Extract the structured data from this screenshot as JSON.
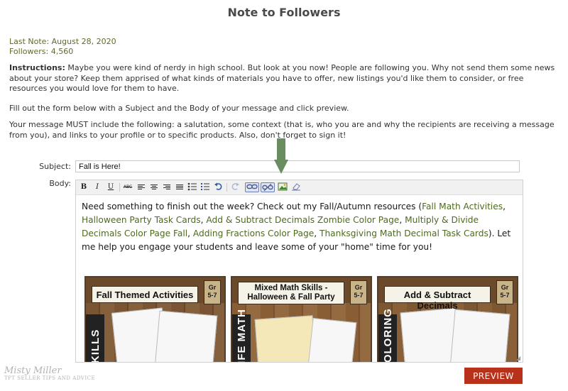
{
  "page": {
    "title": "Note to Followers",
    "last_note": "Last Note: August 28, 2020",
    "followers": "Followers: 4,560"
  },
  "instructions": {
    "label": "Instructions:",
    "text": " Maybe you were kind of nerdy in high school. But look at you now! People are following you. Why not send them some news about your store? Keep them apprised of what kinds of materials you have to offer, new listings you'd like them to consider, or free resources you would love for them to have.",
    "fill_out": "Fill out the form below with a Subject and the Body of your message and click preview.",
    "must_include": "Your message MUST include the following: a salutation, some context (that is, who you are and why the recipients are receiving a message from you), and links to your profile or to specific products. Also, don't forget to sign it!"
  },
  "form": {
    "subject_label": "Subject:",
    "subject_value": "Fall is Here!",
    "body_label": "Body:"
  },
  "toolbar": {
    "bold": "B",
    "italic": "I",
    "underline": "U",
    "spellcheck": "ABC"
  },
  "body": {
    "intro": "Need something to finish out the week? Check out my Fall/Autumn resources (",
    "links": [
      "Fall Math Activities",
      "Halloween Party Task Cards",
      "Add & Subtract Decimals Zombie Color Page",
      "Multiply & Divide Decimals Color Page Fall",
      "Adding Fractions Color Page",
      "Thanksgiving Math Decimal Task Cards"
    ],
    "sep1": ", ",
    "sep2": ", ",
    "sep3": ", ",
    "sep4": ", ",
    "sep5": ", ",
    "outro": "). Let me help you engage your students and leave some of your \"home\" time for you!",
    "thumbnails": [
      {
        "title": "Fall Themed Activities",
        "grade_top": "Gr",
        "grade_bottom": "5-7",
        "spine": "SKILLS"
      },
      {
        "title": "Mixed Math Skills - Halloween & Fall Party",
        "grade_top": "Gr",
        "grade_bottom": "5-7",
        "spine": "LIFE MATH"
      },
      {
        "title": "Add & Subtract Decimals",
        "grade_top": "Gr",
        "grade_bottom": "5-7",
        "spine": "COLORING"
      }
    ]
  },
  "actions": {
    "preview": "PREVIEW"
  },
  "watermark": {
    "line1": "Misty Miller",
    "line2": "TPT SELLER TIPS AND ADVICE"
  },
  "colors": {
    "accent_green": "#5c6b2a",
    "link_green": "#4e6a1f",
    "preview_red": "#b8321b",
    "arrow_green": "#6a8d60"
  }
}
